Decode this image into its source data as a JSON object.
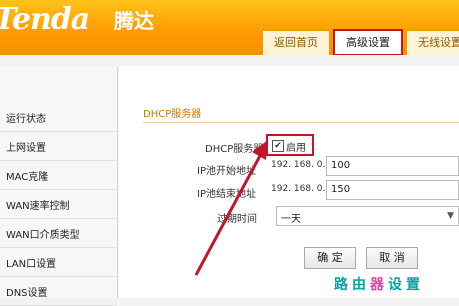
{
  "header": {
    "brand": "Tenda",
    "brand_cn": "腾达"
  },
  "tabs": [
    {
      "label": "返回首页"
    },
    {
      "label": "高级设置",
      "active": true
    },
    {
      "label": "无线设置"
    }
  ],
  "sidebar": {
    "items": [
      {
        "label": "运行状态"
      },
      {
        "label": "上网设置"
      },
      {
        "label": "MAC克隆"
      },
      {
        "label": "WAN速率控制"
      },
      {
        "label": "WAN口介质类型"
      },
      {
        "label": "LAN口设置"
      },
      {
        "label": "DNS设置"
      }
    ]
  },
  "dhcp": {
    "section_title": "DHCP服务器",
    "server_label": "DHCP服务器",
    "enable_label": "启用",
    "enabled": true,
    "start_label": "IP池开始地址",
    "end_label": "IP池结束地址",
    "ip_prefix": "192. 168. 0.",
    "start_value": "100",
    "end_value": "150",
    "lease_label": "过期时间",
    "lease_value": "一天"
  },
  "buttons": {
    "confirm": "确 定",
    "cancel": "取 消"
  },
  "watermark": {
    "part1": "路由",
    "part2": "器",
    "part3": "设置"
  },
  "colors": {
    "header_orange": "#ff9a00",
    "highlight_red": "#c1162a",
    "arrow_red": "#c1162a"
  }
}
